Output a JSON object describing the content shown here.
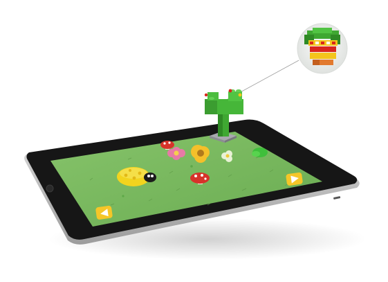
{
  "scene": {
    "subject": "tablet-with-toy-brick-figure",
    "background_color": "#ffffff",
    "tablet": {
      "bezel_color": "#161616",
      "frame_color": "#cfcfcf",
      "screen_color": "#79b95f"
    },
    "game_screen": {
      "elements": [
        "ladybug",
        "mushroom-left",
        "mushroom-right",
        "flower-pink",
        "flower-yellow",
        "flower-white",
        "leaf-green",
        "left-arrow-button",
        "right-arrow-button"
      ],
      "button_color": "#f5c628",
      "ladybug_color": "#f2d41e"
    },
    "brick_figure": {
      "color_green": "#3fa832",
      "color_yellow": "#f4c51c",
      "color_red": "#d8261d",
      "base_color": "#a8a8ae"
    },
    "callout": {
      "shows": "brick-figure-closeup",
      "circle_color": "#eef0ee"
    }
  }
}
